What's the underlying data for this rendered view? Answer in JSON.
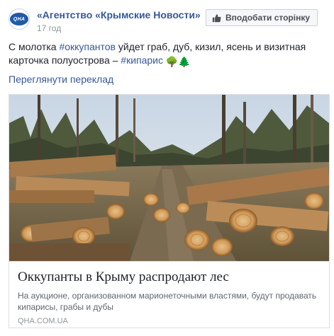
{
  "post": {
    "page_name": "«Агентство «Крымские Новости»",
    "avatar_text": "QHA",
    "time": "17 год",
    "like_button": "Вподобати сторінку",
    "text": {
      "part1": "С молотка ",
      "hashtag1": "#оккупантов",
      "part2": " уйдет граб, дуб, кизил, ясень и визитная карточка полуострова – ",
      "hashtag2": "#кипарис",
      "emoji": "🌳🌲"
    },
    "translate_link": "Переглянути переклад",
    "link_card": {
      "title": "Оккупанты в Крыму распродают лес",
      "description": "На аукционе, организованном марионеточными властями, будут продавать кипарисы, грабы и дубы",
      "domain": "QHA.COM.UA"
    }
  },
  "colors": {
    "link_blue": "#365899",
    "text": "#1d2129",
    "muted": "#90949c",
    "border": "#dddfe2"
  }
}
